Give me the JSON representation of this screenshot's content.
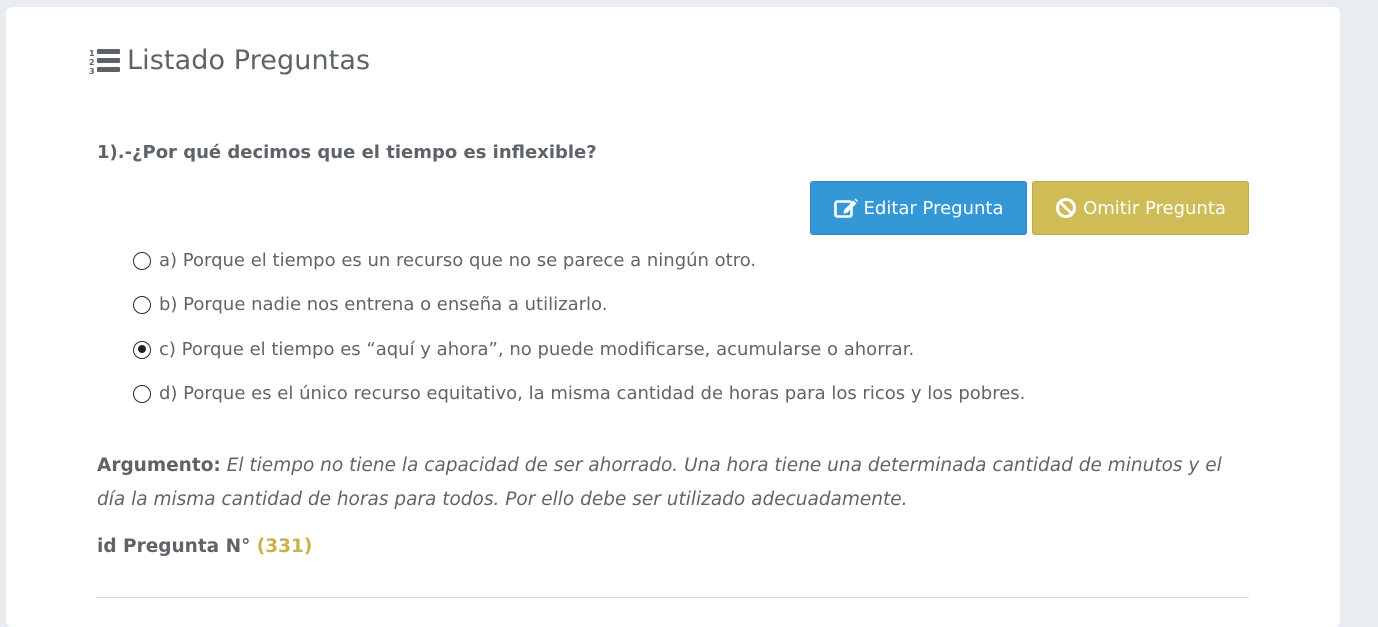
{
  "header": {
    "title": "Listado Preguntas",
    "icon": "list-ol-icon"
  },
  "question": {
    "text": "1).-¿Por qué decimos que el tiempo es inflexible?",
    "options": [
      {
        "label": "a) Porque el tiempo es un recurso que no se parece a ningún otro.",
        "selected": false
      },
      {
        "label": "b) Porque nadie nos entrena o enseña a utilizarlo.",
        "selected": false
      },
      {
        "label": "c) Porque el tiempo es “aquí y ahora”, no puede modificarse, acumularse o ahorrar.",
        "selected": true
      },
      {
        "label": "d) Porque es el único recurso equitativo, la misma cantidad de horas para los ricos y los pobres.",
        "selected": false
      }
    ]
  },
  "actions": {
    "edit_label": "Editar Pregunta",
    "omit_label": "Omitir Pregunta",
    "edit_color": "#3598d6",
    "omit_color": "#d0bc56"
  },
  "argument": {
    "label": "Argumento:",
    "text": "El tiempo no tiene la capacidad de ser ahorrado. Una hora tiene una determinada cantidad de minutos y el día la misma cantidad de horas para todos. Por ello debe ser utilizado adecuadamente."
  },
  "id_info": {
    "label": "id Pregunta N°",
    "value": "(331)"
  }
}
